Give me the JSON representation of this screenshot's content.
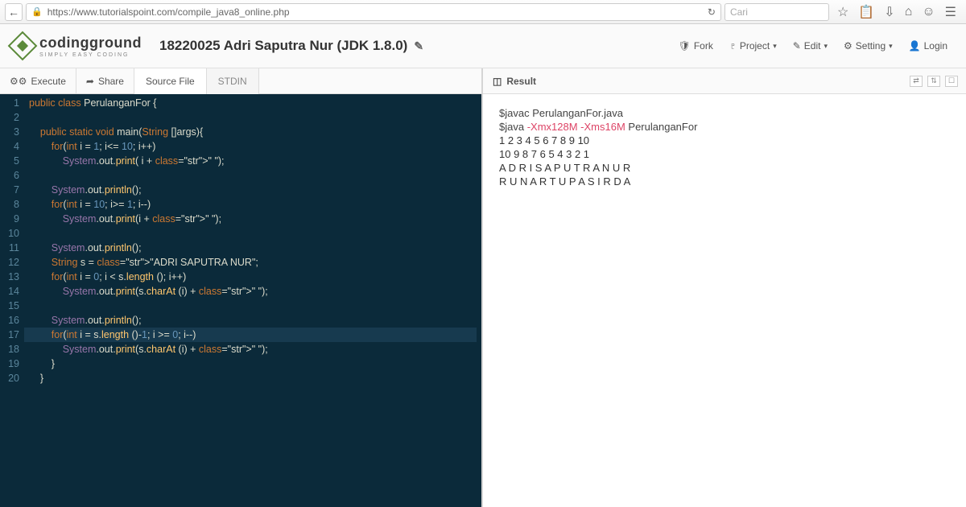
{
  "browser": {
    "url": "https://www.tutorialspoint.com/compile_java8_online.php",
    "search_placeholder": "Cari"
  },
  "logo": {
    "main": "codingground",
    "sub": "SIMPLY EASY CODING"
  },
  "page": {
    "title": "18220025 Adri Saputra Nur (JDK 1.8.0)"
  },
  "header_buttons": {
    "fork": "Fork",
    "project": "Project",
    "edit": "Edit",
    "setting": "Setting",
    "login": "Login"
  },
  "left_toolbar": {
    "execute": "Execute",
    "share": "Share",
    "tab1": "Source File",
    "tab2": "STDIN"
  },
  "right_toolbar": {
    "result": "Result"
  },
  "code": {
    "lines": [
      {
        "n": 1,
        "indent": 0,
        "raw": "public class PerulanganFor {"
      },
      {
        "n": 2,
        "indent": 0,
        "raw": ""
      },
      {
        "n": 3,
        "indent": 1,
        "raw": "public static void main(String []args){"
      },
      {
        "n": 4,
        "indent": 2,
        "raw": "for(int i = 1; i<= 10; i++)"
      },
      {
        "n": 5,
        "indent": 3,
        "raw": "System.out.print( i + \" \");"
      },
      {
        "n": 6,
        "indent": 0,
        "raw": ""
      },
      {
        "n": 7,
        "indent": 2,
        "raw": "System.out.println();"
      },
      {
        "n": 8,
        "indent": 2,
        "raw": "for(int i = 10; i>= 1; i--)"
      },
      {
        "n": 9,
        "indent": 3,
        "raw": "System.out.print(i + \" \");"
      },
      {
        "n": 10,
        "indent": 0,
        "raw": ""
      },
      {
        "n": 11,
        "indent": 2,
        "raw": "System.out.println();"
      },
      {
        "n": 12,
        "indent": 2,
        "raw": "String s = \"ADRI SAPUTRA NUR\";"
      },
      {
        "n": 13,
        "indent": 2,
        "raw": "for(int i = 0; i < s.length (); i++)"
      },
      {
        "n": 14,
        "indent": 3,
        "raw": "System.out.print(s.charAt (i) + \" \");"
      },
      {
        "n": 15,
        "indent": 0,
        "raw": ""
      },
      {
        "n": 16,
        "indent": 2,
        "raw": "System.out.println();"
      },
      {
        "n": 17,
        "indent": 2,
        "raw": "for(int i = s.length ()-1; i >= 0; i--)",
        "highlight": true
      },
      {
        "n": 18,
        "indent": 3,
        "raw": "System.out.print(s.charAt (i) + \" \");"
      },
      {
        "n": 19,
        "indent": 2,
        "raw": "}"
      },
      {
        "n": 20,
        "indent": 1,
        "raw": "}"
      }
    ]
  },
  "output": {
    "cmd1_prefix": "$javac ",
    "cmd1_arg": "PerulanganFor.java",
    "cmd2_prefix": "$java ",
    "cmd2_flags": "-Xmx128M -Xms16M ",
    "cmd2_arg": "PerulanganFor",
    "line1": "1 2 3 4 5 6 7 8 9 10",
    "line2": "10 9 8 7 6 5 4 3 2 1",
    "line3": "A D R I   S A P U T R A   N U R",
    "line4": "R U N   A R T U P A S   I R D A"
  }
}
